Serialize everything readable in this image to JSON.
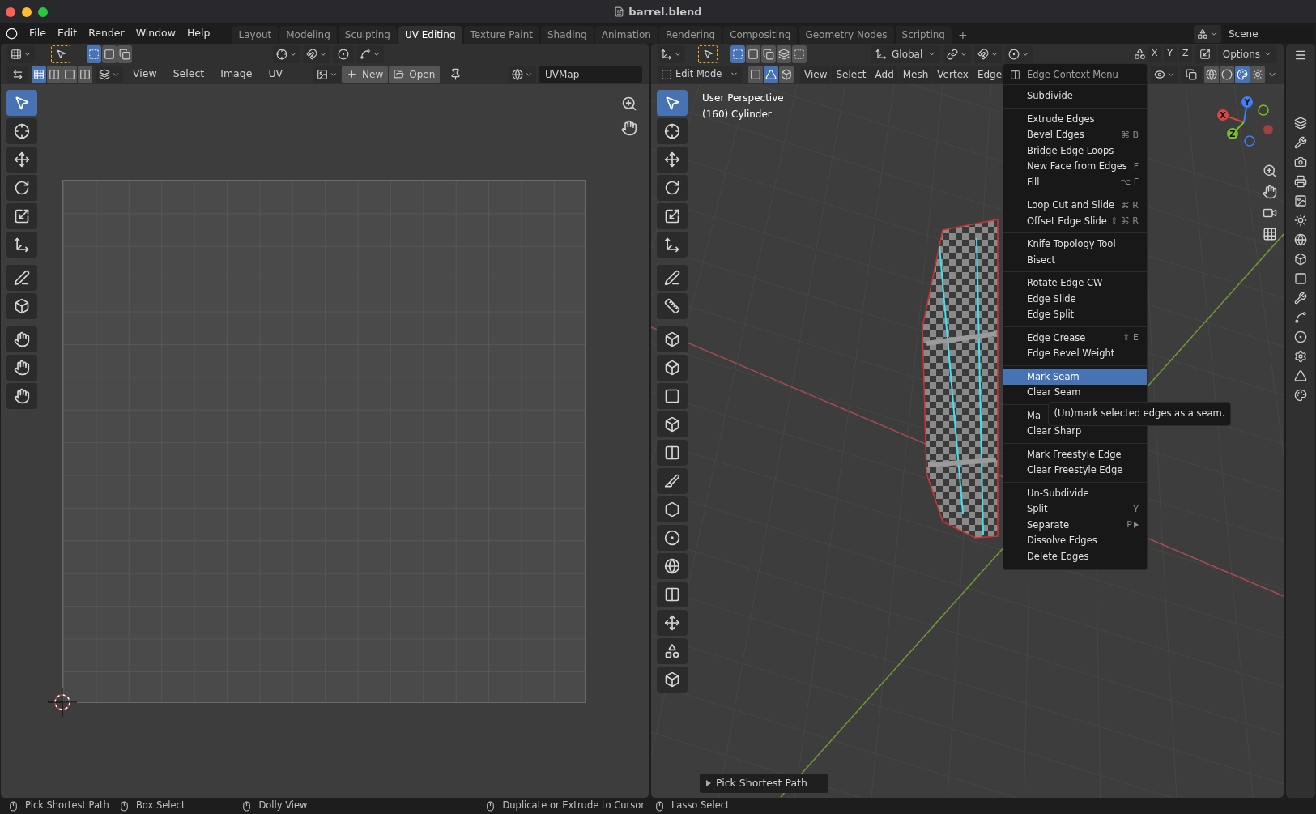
{
  "window": {
    "title": "barrel.blend"
  },
  "menu_bar": [
    "File",
    "Edit",
    "Render",
    "Window",
    "Help"
  ],
  "workspace_tabs": [
    {
      "label": "Layout",
      "selected": false
    },
    {
      "label": "Modeling",
      "selected": false
    },
    {
      "label": "Sculpting",
      "selected": false
    },
    {
      "label": "UV Editing",
      "selected": true
    },
    {
      "label": "Texture Paint",
      "selected": false
    },
    {
      "label": "Shading",
      "selected": false
    },
    {
      "label": "Animation",
      "selected": false
    },
    {
      "label": "Rendering",
      "selected": false
    },
    {
      "label": "Compositing",
      "selected": false
    },
    {
      "label": "Geometry Nodes",
      "selected": false
    },
    {
      "label": "Scripting",
      "selected": false
    }
  ],
  "add_tab": "+",
  "scene": "Scene",
  "uv_editor": {
    "select_modes": [
      {
        "selected": true
      },
      {
        "selected": false
      },
      {
        "selected": false
      }
    ],
    "uv_modes": [
      {
        "selected": true
      },
      {
        "selected": false
      },
      {
        "selected": false
      },
      {
        "selected": false
      }
    ],
    "header_menus": [
      "View",
      "Select",
      "Image",
      "UV"
    ],
    "new_button": "New",
    "open_button": "Open",
    "uv_map": "UVMap",
    "tools": [
      {
        "selected": true
      },
      {
        "selected": false
      },
      {
        "selected": false
      },
      {
        "selected": false
      },
      {
        "selected": false
      },
      {
        "selected": false
      },
      {
        "selected": false
      },
      {
        "selected": false
      },
      {
        "selected": false
      },
      {
        "selected": false
      },
      {
        "selected": false
      }
    ]
  },
  "viewport": {
    "select_modes": [
      {
        "selected": true
      },
      {
        "selected": false
      },
      {
        "selected": false
      },
      {
        "selected": false
      },
      {
        "selected": false
      }
    ],
    "orientation": "Global",
    "axis_buttons": [
      "X",
      "Y",
      "Z"
    ],
    "options": "Options",
    "mode": "Edit Mode",
    "element_modes": [
      {
        "selected": false
      },
      {
        "selected": true
      },
      {
        "selected": false
      }
    ],
    "header_menus": [
      "View",
      "Select",
      "Add",
      "Mesh",
      "Vertex",
      "Edge"
    ],
    "shading_modes": [
      {
        "selected": false
      },
      {
        "selected": false
      },
      {
        "selected": true
      },
      {
        "selected": false
      }
    ],
    "overlay_text": [
      "User Perspective",
      "(160) Cylinder"
    ],
    "gizmo_axes": [
      "X",
      "Y",
      "Z"
    ],
    "tools": [
      {
        "selected": true
      },
      {
        "selected": false
      },
      {
        "selected": false
      },
      {
        "selected": false
      },
      {
        "selected": false
      },
      {
        "selected": false
      },
      {
        "selected": false
      },
      {
        "selected": false
      },
      {
        "selected": false
      },
      {
        "selected": false
      },
      {
        "selected": false
      },
      {
        "selected": false
      },
      {
        "selected": false
      },
      {
        "selected": false
      },
      {
        "selected": false
      },
      {
        "selected": false
      },
      {
        "selected": false
      },
      {
        "selected": false
      },
      {
        "selected": false
      },
      {
        "selected": false
      },
      {
        "selected": false
      }
    ],
    "operator_panel": "Pick Shortest Path"
  },
  "context_menu": {
    "title": "Edge Context Menu",
    "groups": [
      [
        {
          "label": "Subdivide",
          "selected": false
        }
      ],
      [
        {
          "label": "Extrude Edges",
          "selected": false
        },
        {
          "label": "Bevel Edges",
          "shortcut": "⌘ B",
          "selected": false
        },
        {
          "label": "Bridge Edge Loops",
          "selected": false
        },
        {
          "label": "New Face from Edges",
          "shortcut": "F",
          "selected": false
        },
        {
          "label": "Fill",
          "shortcut": "⌥ F",
          "selected": false
        }
      ],
      [
        {
          "label": "Loop Cut and Slide",
          "shortcut": "⌘ R",
          "selected": false
        },
        {
          "label": "Offset Edge Slide",
          "shortcut": "⇧ ⌘ R",
          "selected": false
        }
      ],
      [
        {
          "label": "Knife Topology Tool",
          "selected": false
        },
        {
          "label": "Bisect",
          "selected": false
        }
      ],
      [
        {
          "label": "Rotate Edge CW",
          "selected": false
        },
        {
          "label": "Edge Slide",
          "selected": false
        },
        {
          "label": "Edge Split",
          "selected": false
        }
      ],
      [
        {
          "label": "Edge Crease",
          "shortcut": "⇧ E",
          "selected": false
        },
        {
          "label": "Edge Bevel Weight",
          "selected": false
        }
      ],
      [
        {
          "label": "Mark Seam",
          "selected": true
        },
        {
          "label": "Clear Seam",
          "selected": false
        }
      ],
      [
        {
          "label": "Ma",
          "selected": false
        },
        {
          "label": "Clear Sharp",
          "selected": false
        }
      ],
      [
        {
          "label": "Mark Freestyle Edge",
          "selected": false
        },
        {
          "label": "Clear Freestyle Edge",
          "selected": false
        }
      ],
      [
        {
          "label": "Un-Subdivide",
          "selected": false
        },
        {
          "label": "Split",
          "shortcut": "Y",
          "selected": false
        },
        {
          "label": "Separate",
          "shortcut": "P",
          "submenu": true,
          "selected": false
        },
        {
          "label": "Dissolve Edges",
          "selected": false
        },
        {
          "label": "Delete Edges",
          "selected": false
        }
      ]
    ]
  },
  "tooltip": "(Un)mark selected edges as a seam.",
  "status_bar": [
    "Pick Shortest Path",
    "Box Select",
    "Dolly View",
    "Duplicate or Extrude to Cursor",
    "Lasso Select"
  ]
}
